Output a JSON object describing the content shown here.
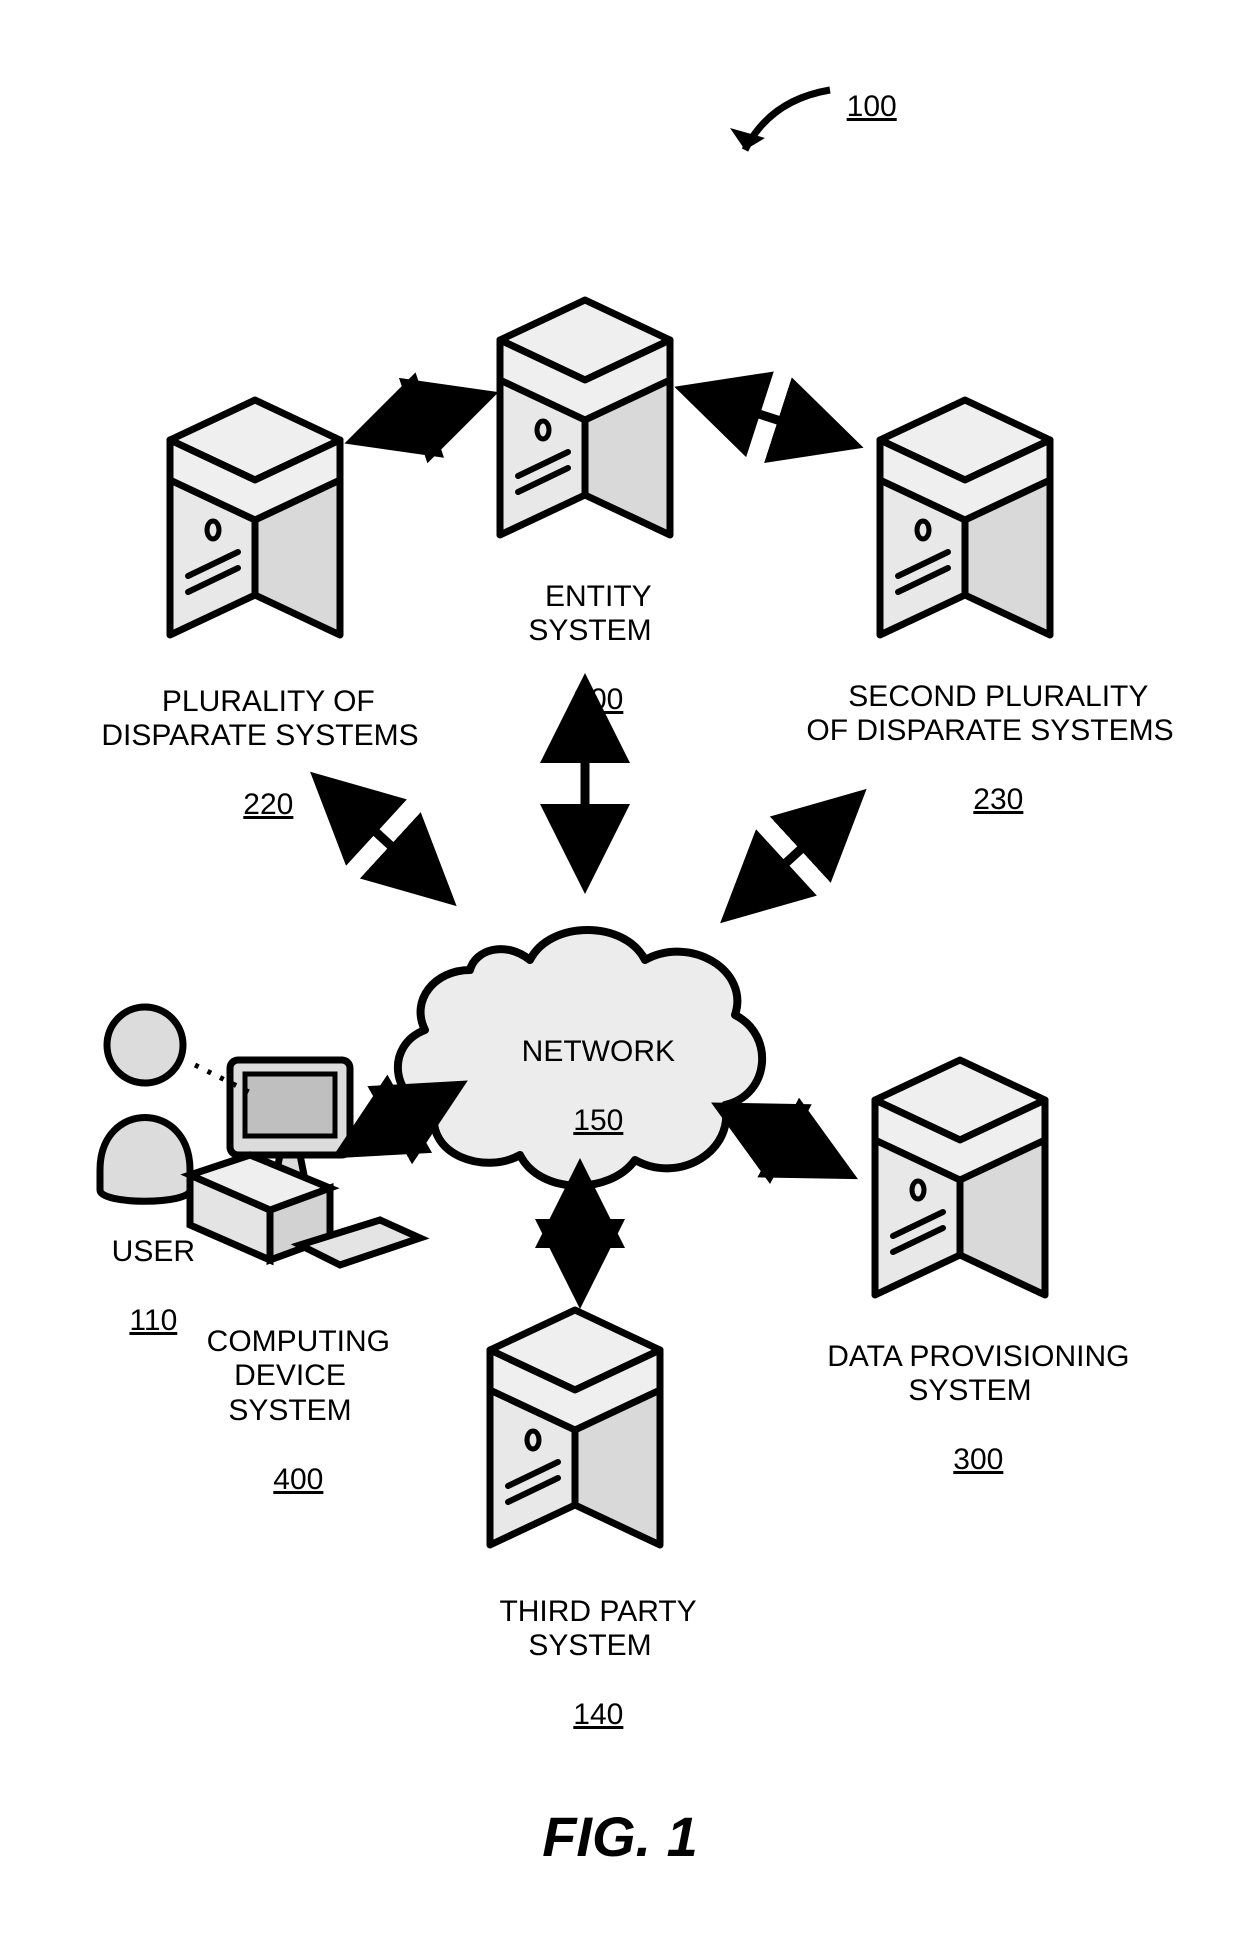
{
  "figure": {
    "caption": "FIG. 1",
    "overall_ref": "100"
  },
  "nodes": {
    "entity": {
      "label": "ENTITY\nSYSTEM",
      "ref": "200"
    },
    "disparate1": {
      "label": "PLURALITY OF\nDISPARATE SYSTEMS",
      "ref": "220"
    },
    "disparate2": {
      "label": "SECOND PLURALITY\nOF DISPARATE SYSTEMS",
      "ref": "230"
    },
    "provisioning": {
      "label": "DATA PROVISIONING\nSYSTEM",
      "ref": "300"
    },
    "thirdparty": {
      "label": "THIRD PARTY\nSYSTEM",
      "ref": "140"
    },
    "computing": {
      "label": "COMPUTING\nDEVICE\nSYSTEM",
      "ref": "400"
    },
    "user": {
      "label": "USER",
      "ref": "110"
    },
    "network": {
      "label": "NETWORK",
      "ref": "150"
    }
  }
}
